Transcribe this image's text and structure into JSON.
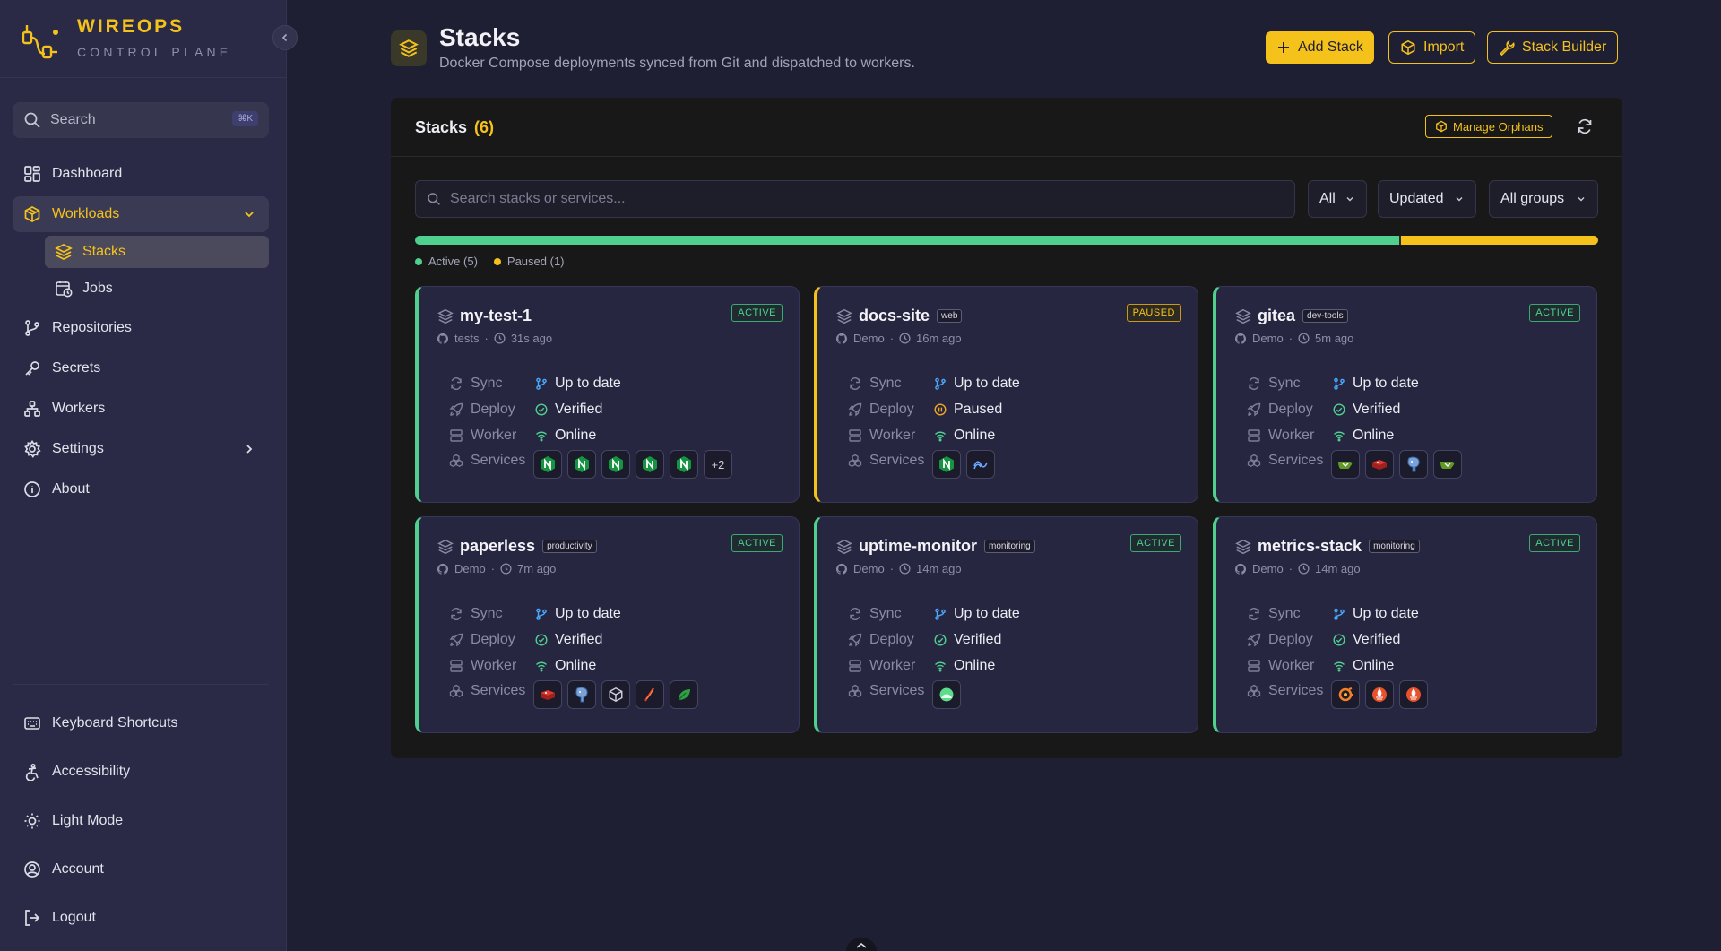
{
  "brand": {
    "name": "WIREOPS",
    "subtitle": "CONTROL PLANE"
  },
  "sidebar": {
    "search_label": "Search",
    "search_shortcut": "⌘K",
    "nav": [
      {
        "label": "Dashboard",
        "icon": "dashboard-icon"
      },
      {
        "label": "Workloads",
        "icon": "box-icon",
        "expanded": true
      },
      {
        "label": "Repositories",
        "icon": "git-branch-icon"
      },
      {
        "label": "Secrets",
        "icon": "key-icon"
      },
      {
        "label": "Workers",
        "icon": "network-icon"
      },
      {
        "label": "Settings",
        "icon": "gear-icon"
      },
      {
        "label": "About",
        "icon": "info-icon"
      }
    ],
    "sub_nav": [
      {
        "label": "Stacks",
        "icon": "layers-icon",
        "active": true
      },
      {
        "label": "Jobs",
        "icon": "calendar-clock-icon"
      }
    ],
    "bottom": [
      {
        "label": "Keyboard Shortcuts",
        "icon": "keyboard-icon"
      },
      {
        "label": "Accessibility",
        "icon": "accessibility-icon"
      },
      {
        "label": "Light Mode",
        "icon": "sun-icon"
      },
      {
        "label": "Account",
        "icon": "user-circle-icon"
      },
      {
        "label": "Logout",
        "icon": "logout-icon"
      }
    ]
  },
  "header": {
    "title": "Stacks",
    "subtitle": "Docker Compose deployments synced from Git and dispatched to workers.",
    "add_label": "Add Stack",
    "import_label": "Import",
    "builder_label": "Stack Builder"
  },
  "panel": {
    "title": "Stacks",
    "count": "(6)",
    "orphans_label": "Manage Orphans",
    "search_placeholder": "Search stacks or services...",
    "filters": {
      "status": "All",
      "sort": "Updated",
      "group": "All groups"
    },
    "progress": {
      "active": 5,
      "paused": 1
    },
    "legend": {
      "active": "Active (5)",
      "paused": "Paused (1)"
    }
  },
  "labels": {
    "sync": "Sync",
    "deploy": "Deploy",
    "worker": "Worker",
    "services": "Services"
  },
  "colors": {
    "accent": "#f5c21b",
    "active": "#4fd08e",
    "paused": "#f5c21b",
    "link": "#4aa8ff"
  },
  "stacks": [
    {
      "name": "my-test-1",
      "tag": "",
      "status": "ACTIVE",
      "repo": "tests",
      "time": "31s ago",
      "sync": "Up to date",
      "deploy": "Verified",
      "worker": "Online",
      "services": [
        "nginx-icon",
        "nginx-icon",
        "nginx-icon",
        "nginx-icon",
        "nginx-icon"
      ],
      "more": "+2"
    },
    {
      "name": "docs-site",
      "tag": "web",
      "status": "PAUSED",
      "repo": "Demo",
      "time": "16m ago",
      "sync": "Up to date",
      "deploy": "Paused",
      "worker": "Online",
      "services": [
        "nginx-icon",
        "astro-icon"
      ],
      "more": ""
    },
    {
      "name": "gitea",
      "tag": "dev-tools",
      "status": "ACTIVE",
      "repo": "Demo",
      "time": "5m ago",
      "sync": "Up to date",
      "deploy": "Verified",
      "worker": "Online",
      "services": [
        "gitea-icon",
        "redis-icon",
        "postgres-icon",
        "gitea-icon"
      ],
      "more": ""
    },
    {
      "name": "paperless",
      "tag": "productivity",
      "status": "ACTIVE",
      "repo": "Demo",
      "time": "7m ago",
      "sync": "Up to date",
      "deploy": "Verified",
      "worker": "Online",
      "services": [
        "redis-icon",
        "postgres-icon",
        "box-icon",
        "feather-icon",
        "leaf-icon"
      ],
      "more": ""
    },
    {
      "name": "uptime-monitor",
      "tag": "monitoring",
      "status": "ACTIVE",
      "repo": "Demo",
      "time": "14m ago",
      "sync": "Up to date",
      "deploy": "Verified",
      "worker": "Online",
      "services": [
        "uptime-kuma-icon"
      ],
      "more": ""
    },
    {
      "name": "metrics-stack",
      "tag": "monitoring",
      "status": "ACTIVE",
      "repo": "Demo",
      "time": "14m ago",
      "sync": "Up to date",
      "deploy": "Verified",
      "worker": "Online",
      "services": [
        "grafana-icon",
        "prometheus-icon",
        "prometheus-icon"
      ],
      "more": ""
    }
  ]
}
